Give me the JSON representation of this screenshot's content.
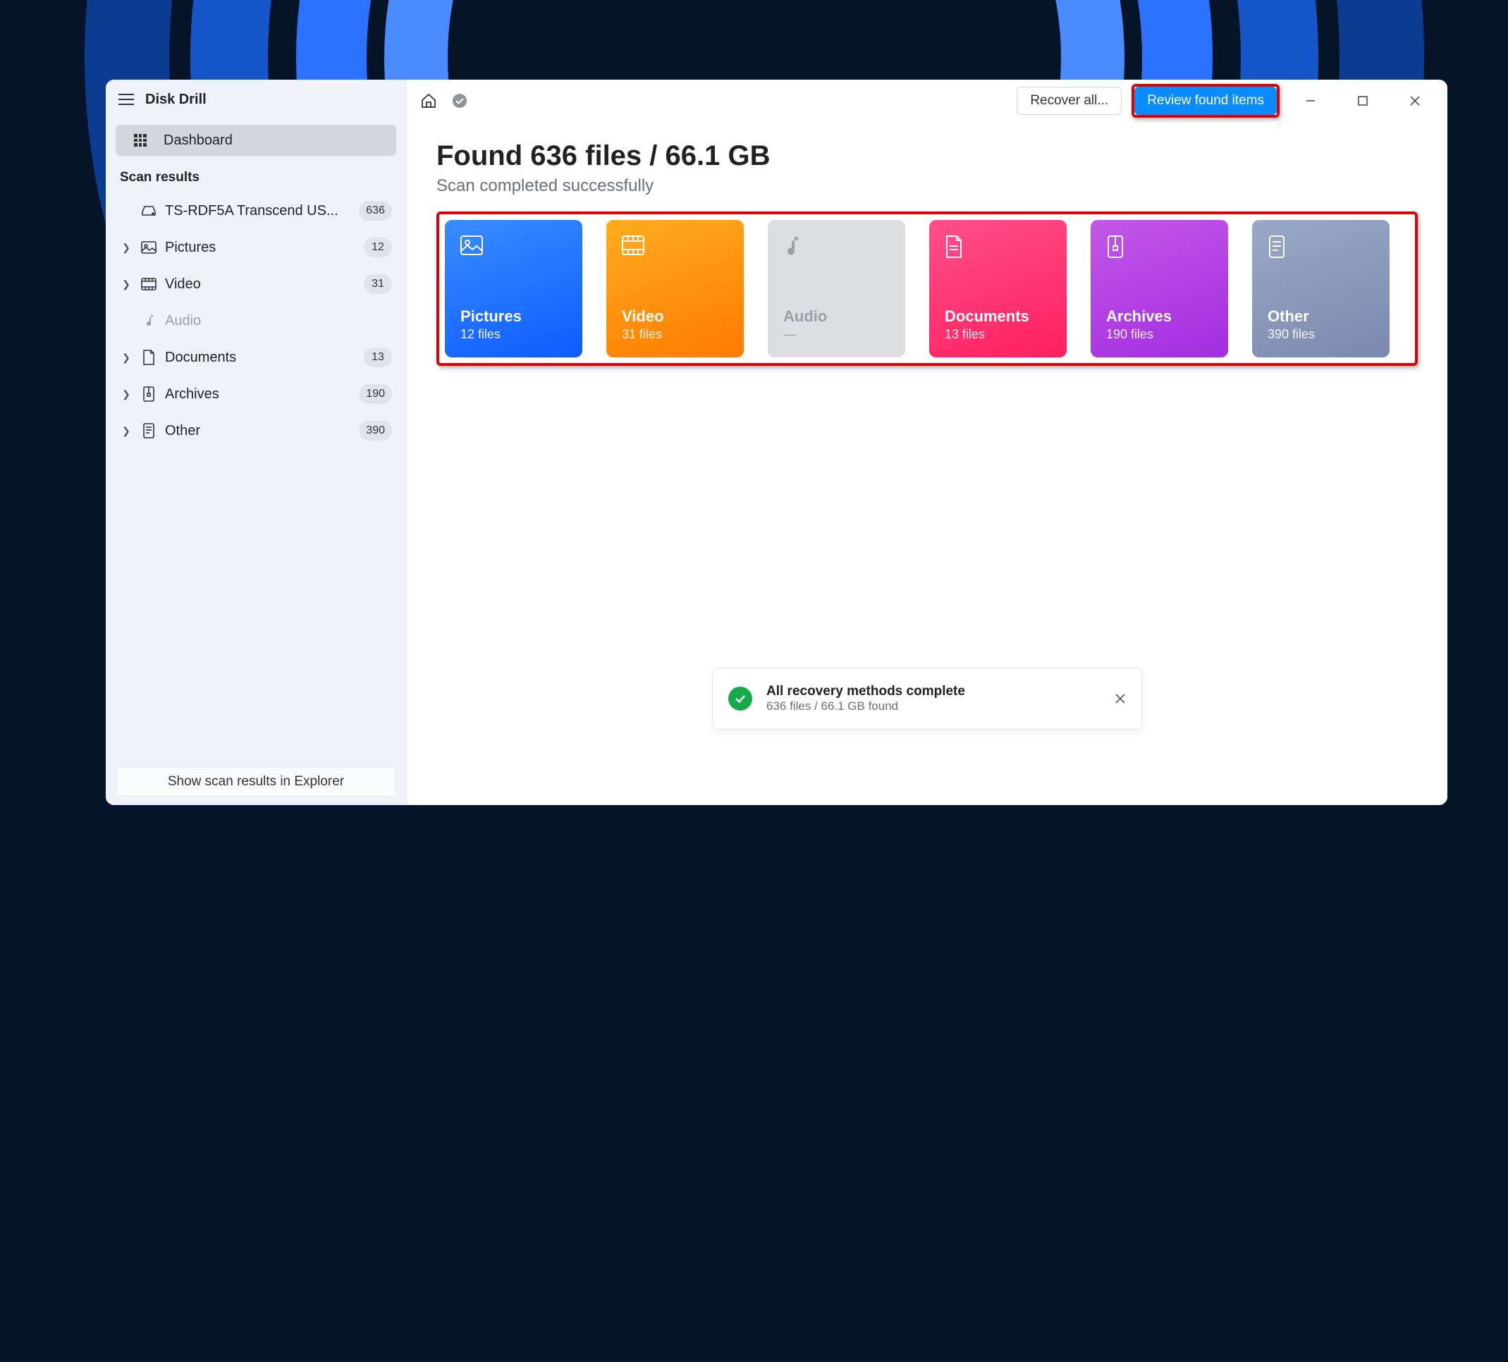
{
  "app_name": "Disk Drill",
  "sidebar": {
    "dashboard_label": "Dashboard",
    "section_label": "Scan results",
    "device_label": "TS-RDF5A Transcend US...",
    "device_count": "636",
    "items": [
      {
        "label": "Pictures",
        "count": "12"
      },
      {
        "label": "Video",
        "count": "31"
      },
      {
        "label": "Audio",
        "count": ""
      },
      {
        "label": "Documents",
        "count": "13"
      },
      {
        "label": "Archives",
        "count": "190"
      },
      {
        "label": "Other",
        "count": "390"
      }
    ],
    "footer_label": "Show scan results in Explorer"
  },
  "topbar": {
    "recover_label": "Recover all...",
    "review_label": "Review found items"
  },
  "main": {
    "headline": "Found 636 files / 66.1 GB",
    "subhead": "Scan completed successfully"
  },
  "cards": {
    "pictures": {
      "title": "Pictures",
      "sub": "12 files"
    },
    "video": {
      "title": "Video",
      "sub": "31 files"
    },
    "audio": {
      "title": "Audio",
      "sub": "—"
    },
    "documents": {
      "title": "Documents",
      "sub": "13 files"
    },
    "archives": {
      "title": "Archives",
      "sub": "190 files"
    },
    "other": {
      "title": "Other",
      "sub": "390 files"
    }
  },
  "toast": {
    "title": "All recovery methods complete",
    "sub": "636 files / 66.1 GB found"
  }
}
